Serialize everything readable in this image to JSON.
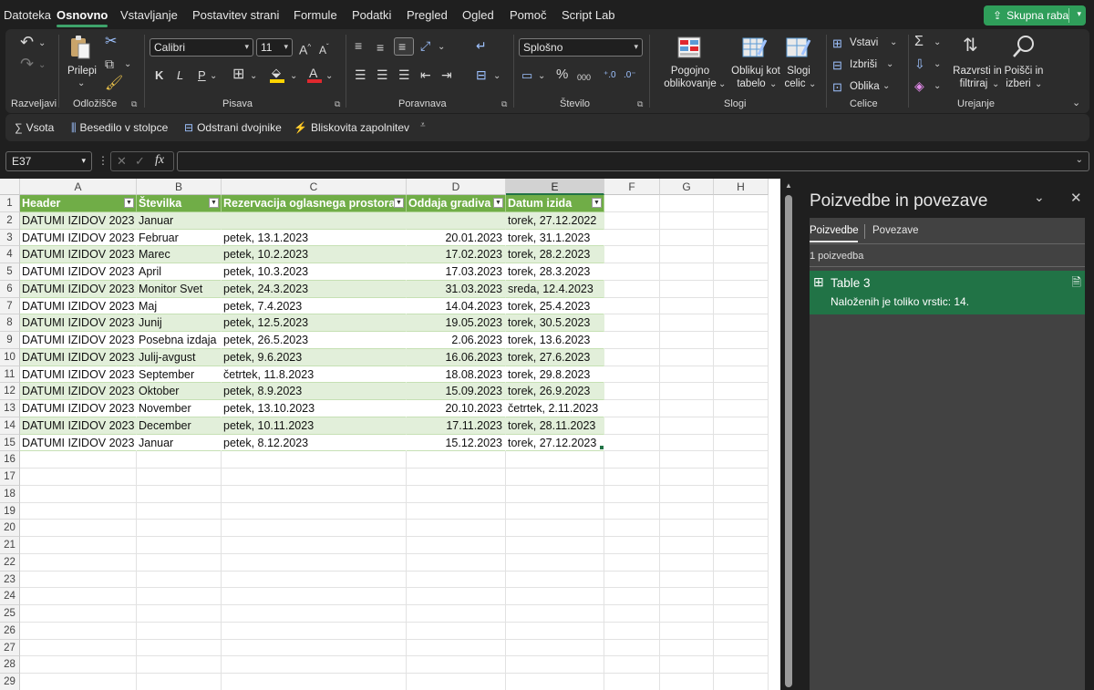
{
  "menu": {
    "tabs": [
      "Datoteka",
      "Osnovno",
      "Vstavljanje",
      "Postavitev strani",
      "Formule",
      "Podatki",
      "Pregled",
      "Ogled",
      "Pomoč",
      "Script Lab"
    ],
    "active_tab": "Osnovno",
    "share_label": "Skupna raba"
  },
  "ribbon": {
    "groups": [
      "Razveljavi",
      "Odložišče",
      "Pisava",
      "Poravnava",
      "Število",
      "Slogi",
      "Celice",
      "Urejanje"
    ],
    "paste_label": "Prilepi",
    "font_name": "Calibri",
    "font_size": "11",
    "number_format": "Splošno",
    "conditional_formatting": [
      "Pogojno",
      "oblikovanje"
    ],
    "format_as_table": [
      "Oblikuj kot",
      "tabelo"
    ],
    "cell_styles": [
      "Slogi",
      "celic"
    ],
    "insert_label": "Vstavi",
    "delete_label": "Izbriši",
    "format_label": "Oblika",
    "sort_filter": [
      "Razvrsti in",
      "filtriraj"
    ],
    "find_select": [
      "Poišči in",
      "izberi"
    ]
  },
  "quickbar": {
    "items": [
      "Vsota",
      "Besedilo v stolpce",
      "Odstrani dvojnike",
      "Bliskovita zapolnitev"
    ]
  },
  "formula_bar": {
    "name_box": "E37",
    "fx_label": "fx",
    "value": ""
  },
  "sheet": {
    "columns": [
      "A",
      "B",
      "C",
      "D",
      "E",
      "F",
      "G",
      "H"
    ],
    "selected_column": "E",
    "selected_cell": "E37",
    "rows": [
      "1",
      "2",
      "3",
      "4",
      "5",
      "6",
      "7",
      "8",
      "9",
      "10",
      "11",
      "12",
      "13",
      "14",
      "15",
      "16",
      "17",
      "18",
      "19",
      "20",
      "21",
      "22",
      "23",
      "24",
      "25",
      "26",
      "27",
      "28",
      "29"
    ],
    "table_headers": [
      "Header",
      "Številka",
      "Rezervacija oglasnega prostora",
      "Oddaja gradiva",
      "Datum izida"
    ],
    "table_rows": [
      [
        "DATUMI IZIDOV 2023",
        "Januar",
        "",
        "",
        "torek, 27.12.2022"
      ],
      [
        "DATUMI IZIDOV 2023",
        "Februar",
        "petek, 13.1.2023",
        "20.01.2023",
        "torek, 31.1.2023"
      ],
      [
        "DATUMI IZIDOV 2023",
        "Marec",
        "petek, 10.2.2023",
        "17.02.2023",
        "torek, 28.2.2023"
      ],
      [
        "DATUMI IZIDOV 2023",
        "April",
        "petek, 10.3.2023",
        "17.03.2023",
        "torek, 28.3.2023"
      ],
      [
        "DATUMI IZIDOV 2023",
        "Monitor Svet",
        "petek, 24.3.2023",
        "31.03.2023",
        "sreda, 12.4.2023"
      ],
      [
        "DATUMI IZIDOV 2023",
        "Maj",
        "petek, 7.4.2023",
        "14.04.2023",
        "torek, 25.4.2023"
      ],
      [
        "DATUMI IZIDOV 2023",
        "Junij",
        "petek, 12.5.2023",
        "19.05.2023",
        "torek, 30.5.2023"
      ],
      [
        "DATUMI IZIDOV 2023",
        "Posebna izdaja",
        "petek, 26.5.2023",
        "2.06.2023",
        "torek, 13.6.2023"
      ],
      [
        "DATUMI IZIDOV 2023",
        "Julij-avgust",
        "petek, 9.6.2023",
        "16.06.2023",
        "torek, 27.6.2023"
      ],
      [
        "DATUMI IZIDOV 2023",
        "September",
        "četrtek, 11.8.2023",
        "18.08.2023",
        "torek, 29.8.2023"
      ],
      [
        "DATUMI IZIDOV 2023",
        "Oktober",
        "petek, 8.9.2023",
        "15.09.2023",
        "torek, 26.9.2023"
      ],
      [
        "DATUMI IZIDOV 2023",
        "November",
        "petek, 13.10.2023",
        "20.10.2023",
        "četrtek, 2.11.2023"
      ],
      [
        "DATUMI IZIDOV 2023",
        "December",
        "petek, 10.11.2023",
        "17.11.2023",
        "torek, 28.11.2023"
      ],
      [
        "DATUMI IZIDOV 2023",
        "Januar",
        "petek, 8.12.2023",
        "15.12.2023",
        "torek, 27.12.2023"
      ]
    ],
    "colors": {
      "table_header": "#70ad47",
      "band": "#e2efda",
      "accent": "#217346"
    }
  },
  "pane": {
    "title": "Poizvedbe in povezave",
    "tabs": [
      "Poizvedbe",
      "Povezave"
    ],
    "active_tab": "Poizvedbe",
    "count": "1 poizvedba",
    "query_name": "Table 3",
    "query_status": "Naloženih je toliko vrstic: 14."
  }
}
